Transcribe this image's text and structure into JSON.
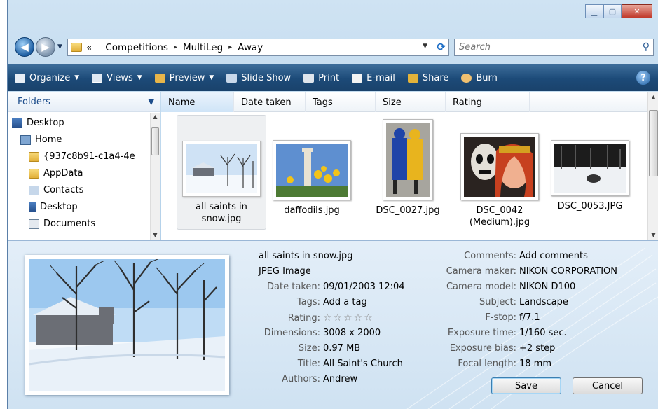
{
  "window": {
    "caption_buttons": {
      "minimize_icon": "minimize-icon",
      "maximize_icon": "maximize-icon",
      "close_icon": "close-icon"
    }
  },
  "address_bar": {
    "prefix": "«",
    "crumbs": [
      "Competitions",
      "MultiLeg",
      "Away"
    ],
    "separator": "▸"
  },
  "search": {
    "placeholder": "Search"
  },
  "toolbar": {
    "organize": "Organize",
    "views": "Views",
    "preview": "Preview",
    "slide_show": "Slide Show",
    "print": "Print",
    "email": "E-mail",
    "share": "Share",
    "burn": "Burn",
    "help": "?"
  },
  "nav_pane": {
    "header": "Folders",
    "items": [
      "Desktop",
      "Home",
      "{937c8b91-c1a4-4e",
      "AppData",
      "Contacts",
      "Desktop",
      "Documents"
    ]
  },
  "columns": [
    "Name",
    "Date taken",
    "Tags",
    "Size",
    "Rating"
  ],
  "files": [
    {
      "name": "all saints in snow.jpg",
      "selected": true
    },
    {
      "name": "daffodils.jpg",
      "selected": false
    },
    {
      "name": "DSC_0027.jpg",
      "selected": false
    },
    {
      "name": "DSC_0042 (Medium).jpg",
      "selected": false
    },
    {
      "name": "DSC_0053.JPG",
      "selected": false
    }
  ],
  "details": {
    "filename": "all saints in snow.jpg",
    "filetype": "JPEG Image",
    "left_props": [
      {
        "label": "Date taken:",
        "value": "09/01/2003 12:04"
      },
      {
        "label": "Tags:",
        "value": "Add a tag"
      },
      {
        "label": "Rating:",
        "value": "☆☆☆☆☆"
      },
      {
        "label": "Dimensions:",
        "value": "3008 x 2000"
      },
      {
        "label": "Size:",
        "value": "0.97 MB"
      },
      {
        "label": "Title:",
        "value": "All Saint's Church"
      },
      {
        "label": "Authors:",
        "value": "Andrew"
      }
    ],
    "right_props": [
      {
        "label": "Comments:",
        "value": "Add comments"
      },
      {
        "label": "Camera maker:",
        "value": "NIKON CORPORATION"
      },
      {
        "label": "Camera model:",
        "value": "NIKON D100"
      },
      {
        "label": "Subject:",
        "value": "Landscape"
      },
      {
        "label": "F-stop:",
        "value": "f/7.1"
      },
      {
        "label": "Exposure time:",
        "value": "1/160 sec."
      },
      {
        "label": "Exposure bias:",
        "value": "+2 step"
      },
      {
        "label": "Focal length:",
        "value": "18 mm"
      }
    ],
    "save_label": "Save",
    "cancel_label": "Cancel"
  }
}
